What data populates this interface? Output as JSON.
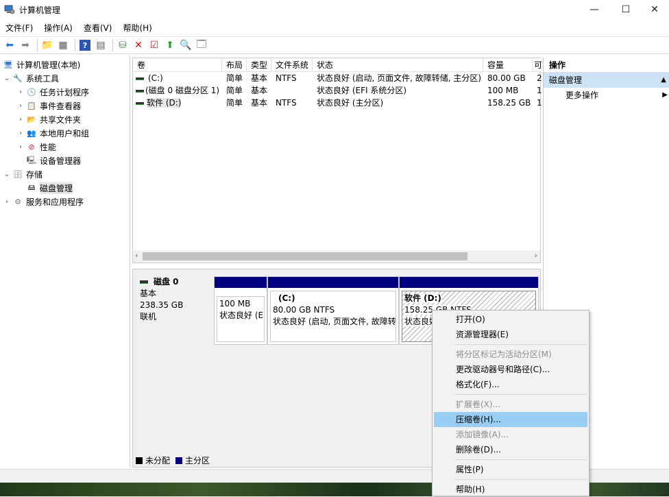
{
  "window": {
    "title": "计算机管理",
    "min": "—",
    "max": "☐",
    "close": "✕"
  },
  "menu": [
    "文件(F)",
    "操作(A)",
    "查看(V)",
    "帮助(H)"
  ],
  "tree": {
    "root": "计算机管理(本地)",
    "system_tools": "系统工具",
    "task_scheduler": "任务计划程序",
    "event_viewer": "事件查看器",
    "shared_folders": "共享文件夹",
    "local_users": "本地用户和组",
    "performance": "性能",
    "device_manager": "设备管理器",
    "storage": "存储",
    "disk_management": "磁盘管理",
    "services_apps": "服务和应用程序"
  },
  "volumes": {
    "headers": [
      "卷",
      "布局",
      "类型",
      "文件系统",
      "状态",
      "容量",
      "可"
    ],
    "rows": [
      [
        "(C:)",
        "简单",
        "基本",
        "NTFS",
        "状态良好 (启动, 页面文件, 故障转储, 主分区)",
        "80.00 GB",
        "2"
      ],
      [
        "(磁盘 0 磁盘分区 1)",
        "简单",
        "基本",
        "",
        "状态良好 (EFI 系统分区)",
        "100 MB",
        "1"
      ],
      [
        "软件 (D:)",
        "简单",
        "基本",
        "NTFS",
        "状态良好 (主分区)",
        "158.25 GB",
        "1"
      ]
    ]
  },
  "disk": {
    "name": "磁盘 0",
    "type": "基本",
    "size": "238.35 GB",
    "status": "联机",
    "partitions": [
      {
        "title": "",
        "size": "100 MB",
        "status": "状态良好 (E"
      },
      {
        "title": "(C:)",
        "size": "80.00 GB NTFS",
        "status": "状态良好 (启动, 页面文件, 故障转"
      },
      {
        "title": "软件  (D:)",
        "size": "158.25 GB NTFS",
        "status": "状态良好"
      }
    ]
  },
  "legend": {
    "unallocated": "未分配",
    "primary": "主分区"
  },
  "actions": {
    "header": "操作",
    "section": "磁盘管理",
    "more": "更多操作"
  },
  "context_menu": {
    "open": "打开(O)",
    "explorer": "资源管理器(E)",
    "mark_active": "将分区标记为活动分区(M)",
    "change_letter": "更改驱动器号和路径(C)...",
    "format": "格式化(F)...",
    "extend": "扩展卷(X)...",
    "shrink": "压缩卷(H)...",
    "add_mirror": "添加镜像(A)...",
    "delete": "删除卷(D)...",
    "properties": "属性(P)",
    "help": "帮助(H)"
  },
  "colors": {
    "primary_partition": "#000080",
    "unallocated": "#000000",
    "highlight": "#99cdf3",
    "action_selected": "#cde3f5"
  }
}
